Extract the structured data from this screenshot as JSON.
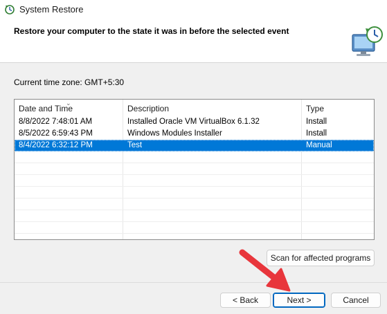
{
  "window": {
    "title": "System Restore"
  },
  "header": {
    "text": "Restore your computer to the state it was in before the selected event"
  },
  "timezone": "Current time zone: GMT+5:30",
  "table": {
    "columns": [
      "Date and Time",
      "Description",
      "Type"
    ],
    "rows": [
      {
        "date": "8/8/2022 7:48:01 AM",
        "description": "Installed Oracle VM VirtualBox 6.1.32",
        "type": "Install",
        "selected": false
      },
      {
        "date": "8/5/2022 6:59:43 PM",
        "description": "Windows Modules Installer",
        "type": "Install",
        "selected": false
      },
      {
        "date": "8/4/2022 6:32:12 PM",
        "description": "Test",
        "type": "Manual",
        "selected": true
      }
    ]
  },
  "buttons": {
    "scan": "Scan for affected programs",
    "back": "< Back",
    "next": "Next >",
    "cancel": "Cancel"
  },
  "colors": {
    "selection": "#0078d7",
    "annotation_arrow": "#e8363c"
  },
  "icons": [
    "system-restore-icon",
    "restore-monitor-icon",
    "sort-caret-icon",
    "annotation-arrow-icon"
  ]
}
